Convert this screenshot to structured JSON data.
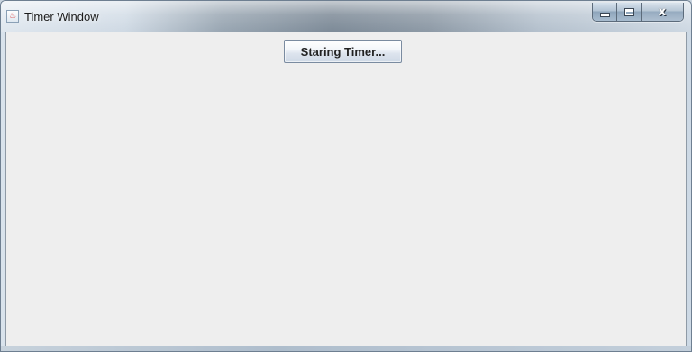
{
  "window": {
    "title": "Timer Window",
    "app_icon": "java-icon"
  },
  "caption_buttons": {
    "minimize_icon": "minimize-icon",
    "maximize_icon": "maximize-icon",
    "close_icon": "close-icon",
    "close_glyph": "x"
  },
  "content": {
    "start_button_label": "Staring Timer..."
  },
  "colors": {
    "client_background": "#eeeeee",
    "button_border": "#7a8ba0"
  }
}
